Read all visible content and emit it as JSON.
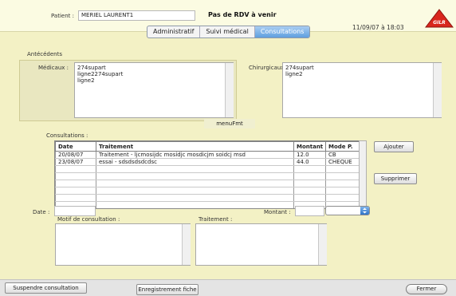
{
  "header": {
    "patient_label": "Patient :",
    "patient_value": "MERIEL LAURENT1",
    "rdv_status": "Pas de RDV à venir",
    "datetime": "11/09/07 à 18:03",
    "logo_text": "GILR"
  },
  "tabs": [
    {
      "label": "Administratif",
      "active": false
    },
    {
      "label": "Suivi médical",
      "active": false
    },
    {
      "label": "Consultations",
      "active": true
    }
  ],
  "antecedents": {
    "section_label": "Antécédents",
    "medicaux_label": "Médicaux :",
    "medicaux_lines": [
      "274supart",
      "ligne2274supart",
      "ligne2"
    ],
    "chirurgicaux_label": "Chirurgicaux :",
    "chirurgicaux_lines": [
      "274supart",
      "ligne2"
    ]
  },
  "menu_fmt_label": "menuFmt",
  "consultations": {
    "label": "Consultations :",
    "columns": [
      "Date",
      "Traitement",
      "Montant",
      "Mode P."
    ],
    "rows": [
      [
        "20/08/07",
        "Traitement - ljcmosijdc mosidjc mosdicjm soidcj msd",
        "12.0",
        "CB"
      ],
      [
        "23/08/07",
        "essai - sdsdsdsdcdsc",
        "44.0",
        "CHEQUE"
      ],
      [
        "",
        "",
        "",
        ""
      ],
      [
        "",
        "",
        "",
        ""
      ],
      [
        "",
        "",
        "",
        ""
      ],
      [
        "",
        "",
        "",
        ""
      ],
      [
        "",
        "",
        "",
        ""
      ],
      [
        "",
        "",
        "",
        ""
      ]
    ]
  },
  "buttons": {
    "ajouter": "Ajouter",
    "supprimer": "Supprimer",
    "suspendre": "Suspendre consultation",
    "enregistrement": "Enregistrement fiche",
    "fermer": "Fermer"
  },
  "form": {
    "date_label": "Date :",
    "date_value": "",
    "montant_label": "Montant :",
    "montant_value": "",
    "mode_select_value": "",
    "motif_label": "Motif de consultation :",
    "motif_value": "",
    "traitement_label": "Traitement :",
    "traitement_value": ""
  },
  "colors": {
    "background": "#f3f1c5",
    "active_tab": "#5f9fdf",
    "logo_red": "#d9261c"
  }
}
